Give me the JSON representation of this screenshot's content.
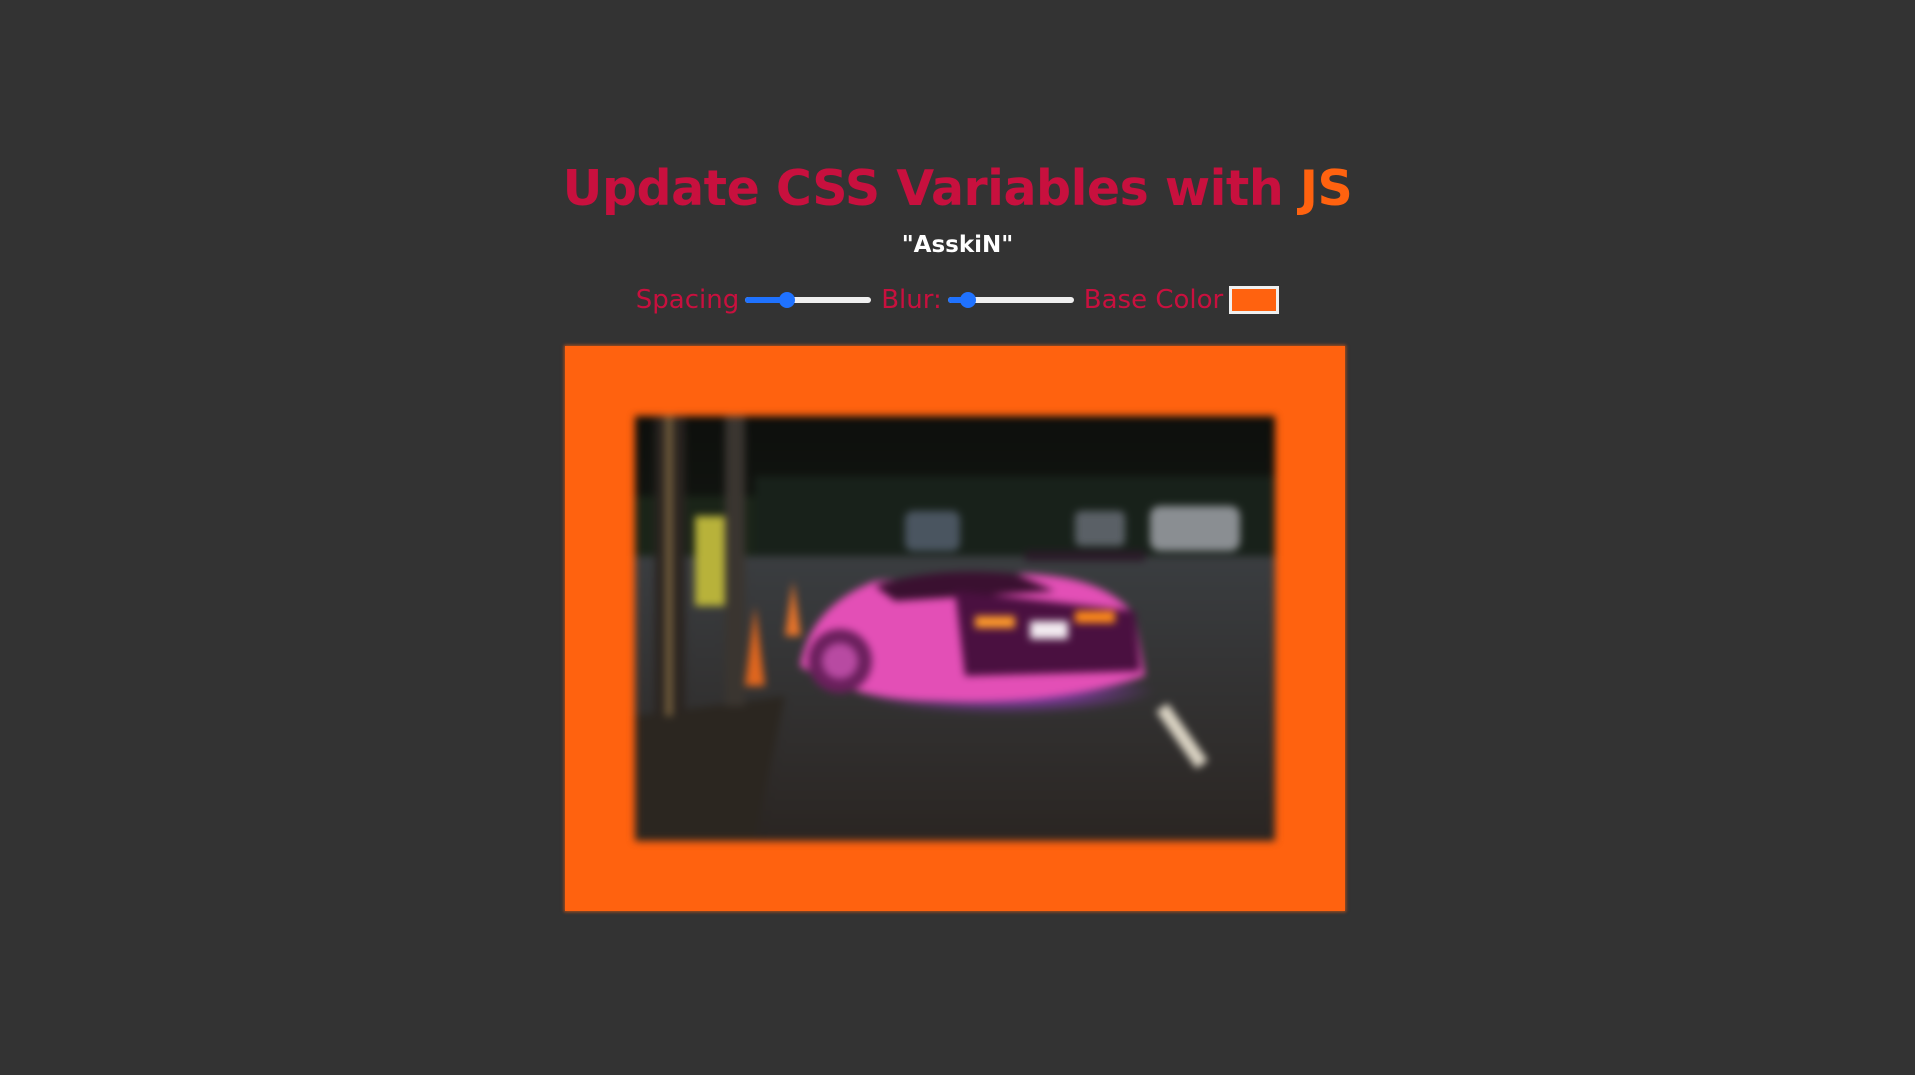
{
  "header": {
    "title_main": "Update CSS Variables with ",
    "title_highlight": "JS",
    "author": "\"AsskiN\""
  },
  "controls": {
    "spacing": {
      "label": "Spacing",
      "value_fraction": 0.33
    },
    "blur": {
      "label": "Blur:",
      "value_fraction": 0.16
    },
    "base_color": {
      "label": "Base Color",
      "value": "#ff620f"
    }
  },
  "colors": {
    "background": "#333333",
    "accent": "#c8103e",
    "base": "#ff620f",
    "slider": "#1f72ff"
  },
  "image": {
    "description_icon": "photo-lamborghini-night"
  }
}
